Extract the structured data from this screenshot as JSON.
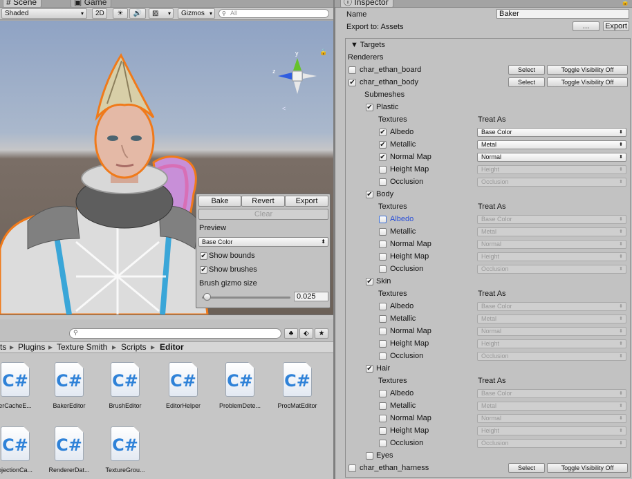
{
  "scene_tabs": {
    "scene": "Scene",
    "game": "Game"
  },
  "scene_toolbar": {
    "shading": "Shaded",
    "two_d": "2D",
    "gizmos": "Gizmos",
    "search_placeholder": "All"
  },
  "bake_panel": {
    "bake": "Bake",
    "revert": "Revert",
    "export": "Export",
    "clear": "Clear",
    "preview_label": "Preview",
    "preview_value": "Base Color",
    "show_bounds": "Show bounds",
    "show_brushes": "Show brushes",
    "gizmo_size_label": "Brush gizmo size",
    "gizmo_size_value": "0.025",
    "gizmo_slider_level": 0.05
  },
  "project": {
    "breadcrumb": [
      "ts",
      "Plugins",
      "Texture Smith",
      "Scripts",
      "Editor"
    ],
    "files": [
      "erCacheE...",
      "BakerEditor",
      "BrushEditor",
      "EditorHelper",
      "ProblemDete...",
      "ProcMatEditor",
      "ojectionCa...",
      "RendererDat...",
      "TextureGrou..."
    ]
  },
  "inspector": {
    "tab": "Inspector",
    "name_label": "Name",
    "name_value": "Baker",
    "export_label": "Export to: Assets",
    "dots_button": "...",
    "export_button": "Export",
    "targets": "Targets",
    "renderers": "Renderers",
    "submeshes": "Submeshes",
    "textures": "Textures",
    "treat_as": "Treat As",
    "select": "Select",
    "toggle_visibility": "Toggle Visibility Off",
    "renderer_board": "char_ethan_board",
    "renderer_body": "char_ethan_body",
    "renderer_harness": "char_ethan_harness",
    "submesh_plastic": "Plastic",
    "submesh_body": "Body",
    "submesh_skin": "Skin",
    "submesh_hair": "Hair",
    "submesh_eyes": "Eyes",
    "tex_albedo": "Albedo",
    "tex_metallic": "Metallic",
    "tex_normal": "Normal Map",
    "tex_height": "Height Map",
    "tex_occlusion": "Occlusion",
    "opt_base_color": "Base Color",
    "opt_metal": "Metal",
    "opt_normal": "Normal",
    "opt_height": "Height",
    "opt_occlusion": "Occlusion"
  },
  "colors": {
    "selection_outline": "#f07a1a",
    "highlight_text": "#2a4fd8",
    "gizmo_green": "#66c22a",
    "gizmo_blue": "#2f5de0",
    "gizmo_red": "#d22020"
  }
}
